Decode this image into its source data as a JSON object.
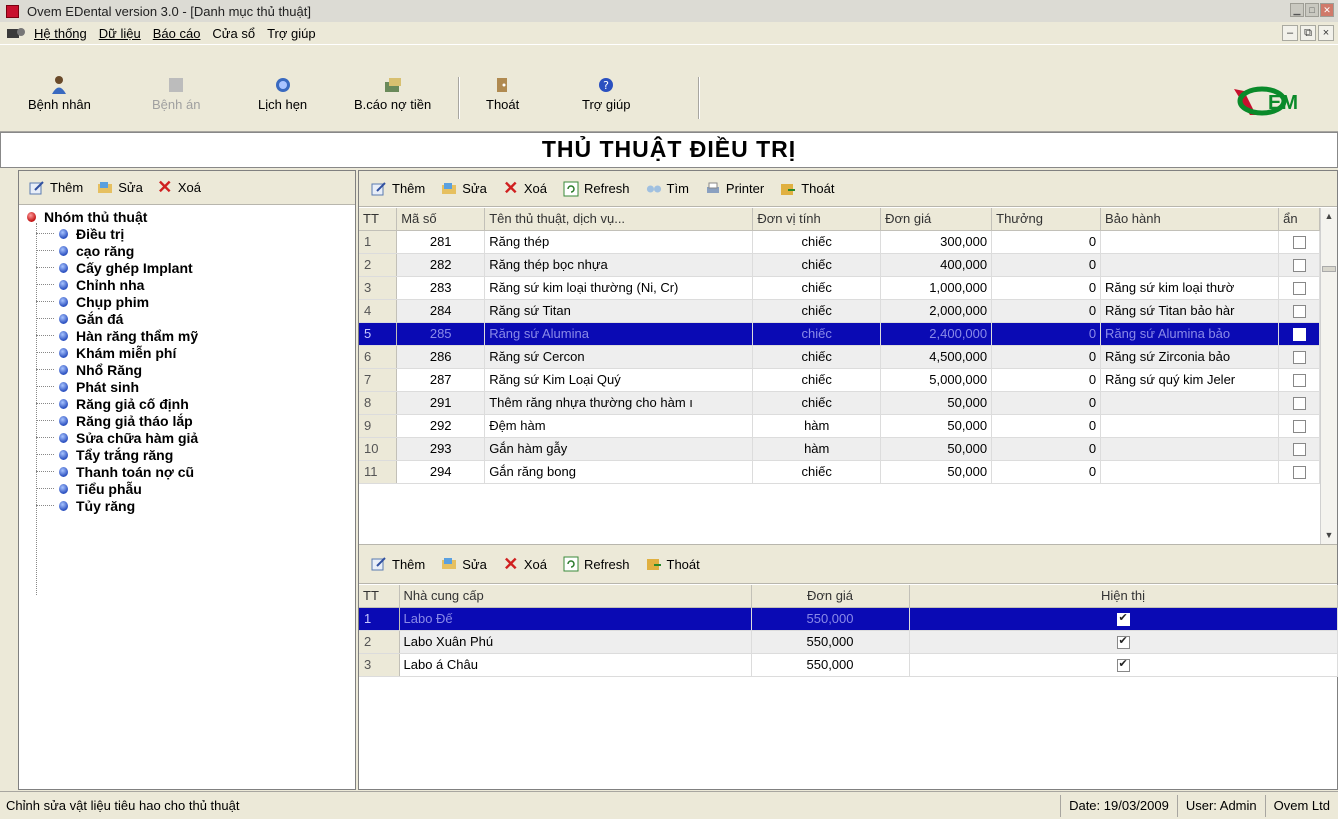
{
  "window": {
    "title": "Ovem EDental version 3.0 - [Danh mục thủ thuật]"
  },
  "menu": [
    {
      "label": "Hệ thống",
      "name": "menu-he-thong"
    },
    {
      "label": "Dữ liệu",
      "name": "menu-du-lieu"
    },
    {
      "label": "Báo cáo",
      "name": "menu-bao-cao"
    },
    {
      "label": "Cửa sổ",
      "name": "menu-cua-so"
    },
    {
      "label": "Trợ giúp",
      "name": "menu-tro-giup"
    }
  ],
  "toolbar": {
    "benh_nhan": "Bệnh nhân",
    "benh_an": "Bệnh án",
    "lich_hen": "Lịch hẹn",
    "bao_cao_no": "B.cáo nợ tiền",
    "thoat": "Thoát",
    "tro_giup": "Trợ giúp"
  },
  "logo_text": "OVEM",
  "page_title": "THỦ THUẬT ĐIỀU TRỊ",
  "left_tools": {
    "them": "Thêm",
    "sua": "Sửa",
    "xoa": "Xoá"
  },
  "tree": {
    "root": "Nhóm thủ thuật",
    "items": [
      "Điều trị",
      "cạo răng",
      "Cấy ghép Implant",
      "Chỉnh nha",
      "Chụp phim",
      "Gắn đá",
      "Hàn răng thẩm mỹ",
      "Khám miễn phí",
      "Nhổ Răng",
      "Phát sinh",
      "Răng giả cố định",
      "Răng giả tháo lắp",
      "Sửa chữa hàm giả",
      "Tẩy trắng răng",
      "Thanh toán nợ cũ",
      "Tiểu phẫu",
      "Tủy răng"
    ]
  },
  "main_tools": {
    "them": "Thêm",
    "sua": "Sửa",
    "xoa": "Xoá",
    "refresh": "Refresh",
    "tim": "Tìm",
    "printer": "Printer",
    "thoat": "Thoát"
  },
  "procedures": {
    "headers": [
      "TT",
      "Mã số",
      "Tên thủ thuật, dịch vụ...",
      "Đơn vị tính",
      "Đơn giá",
      "Thưởng",
      "Bảo hành",
      "ẩn"
    ],
    "rows": [
      {
        "tt": "1",
        "ma": "281",
        "ten": "Răng thép",
        "dvt": "chiếc",
        "gia": "300,000",
        "thuong": "0",
        "bh": ""
      },
      {
        "tt": "2",
        "ma": "282",
        "ten": "Răng thép bọc nhựa",
        "dvt": "chiếc",
        "gia": "400,000",
        "thuong": "0",
        "bh": ""
      },
      {
        "tt": "3",
        "ma": "283",
        "ten": "Răng sứ kim loại thường (Ni, Cr)",
        "dvt": "chiếc",
        "gia": "1,000,000",
        "thuong": "0",
        "bh": "Răng sứ kim loại thườ"
      },
      {
        "tt": "4",
        "ma": "284",
        "ten": "Răng sứ Titan",
        "dvt": "chiếc",
        "gia": "2,000,000",
        "thuong": "0",
        "bh": "Răng sứ Titan bảo hàr"
      },
      {
        "tt": "5",
        "ma": "285",
        "ten": "Răng sứ Alumina",
        "dvt": "chiếc",
        "gia": "2,400,000",
        "thuong": "0",
        "bh": "Răng sứ Alumina bảo"
      },
      {
        "tt": "6",
        "ma": "286",
        "ten": "Răng sứ Cercon",
        "dvt": "chiếc",
        "gia": "4,500,000",
        "thuong": "0",
        "bh": "Răng sứ Zirconia bảo"
      },
      {
        "tt": "7",
        "ma": "287",
        "ten": "Răng sứ Kim Loại Quý",
        "dvt": "chiếc",
        "gia": "5,000,000",
        "thuong": "0",
        "bh": "Răng sứ quý kim Jeler"
      },
      {
        "tt": "8",
        "ma": "291",
        "ten": "Thêm răng nhựa thường cho hàm ı",
        "dvt": "chiếc",
        "gia": "50,000",
        "thuong": "0",
        "bh": ""
      },
      {
        "tt": "9",
        "ma": "292",
        "ten": "Đệm hàm",
        "dvt": "hàm",
        "gia": "50,000",
        "thuong": "0",
        "bh": ""
      },
      {
        "tt": "10",
        "ma": "293",
        "ten": "Gắn hàm gẫy",
        "dvt": "hàm",
        "gia": "50,000",
        "thuong": "0",
        "bh": ""
      },
      {
        "tt": "11",
        "ma": "294",
        "ten": "Gắn răng bong",
        "dvt": "chiếc",
        "gia": "50,000",
        "thuong": "0",
        "bh": ""
      }
    ],
    "selected_index": 4
  },
  "sub_tools": {
    "them": "Thêm",
    "sua": "Sửa",
    "xoa": "Xoá",
    "refresh": "Refresh",
    "thoat": "Thoát"
  },
  "suppliers": {
    "headers": [
      "TT",
      "Nhà cung cấp",
      "Đơn giá",
      "Hiện thị"
    ],
    "rows": [
      {
        "tt": "1",
        "ncc": "Labo Đế",
        "gia": "550,000",
        "show": true
      },
      {
        "tt": "2",
        "ncc": "Labo Xuân Phú",
        "gia": "550,000",
        "show": true
      },
      {
        "tt": "3",
        "ncc": "Labo á Châu",
        "gia": "550,000",
        "show": true
      }
    ],
    "selected_index": 0
  },
  "status": {
    "message": "Chỉnh sửa vật liệu tiêu hao cho thủ thuật",
    "date": "Date: 19/03/2009",
    "user": "User: Admin",
    "company": "Ovem Ltd"
  },
  "colors": {
    "selection": "#0a0ab4",
    "accent_red": "#c8102e",
    "accent_green": "#0a8a2a"
  }
}
